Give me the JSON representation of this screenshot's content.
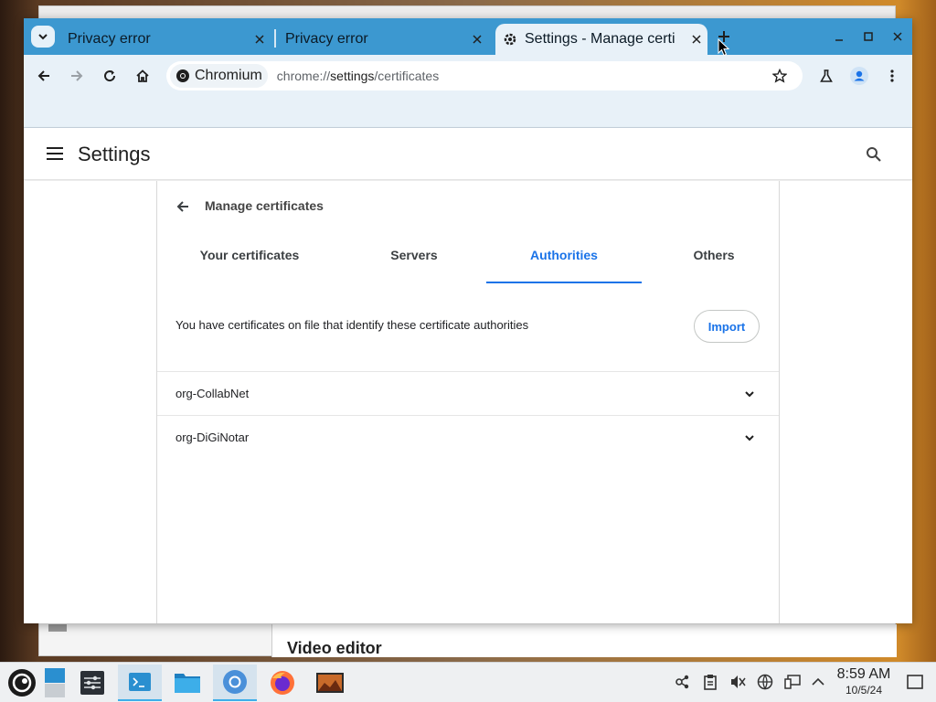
{
  "browser": {
    "tabs": [
      {
        "title": "Privacy error",
        "active": false
      },
      {
        "title": "Privacy error",
        "active": false
      },
      {
        "title": "Settings - Manage certi",
        "active": true
      }
    ],
    "omnibox": {
      "chip": "Chromium",
      "url_prefix": "chrome://",
      "url_host": "settings",
      "url_path": "/certificates"
    }
  },
  "settings": {
    "title": "Settings",
    "page_title": "Manage certificates",
    "tabs": [
      {
        "label": "Your certificates",
        "selected": false
      },
      {
        "label": "Servers",
        "selected": false
      },
      {
        "label": "Authorities",
        "selected": true
      },
      {
        "label": "Others",
        "selected": false
      }
    ],
    "description": "You have certificates on file that identify these certificate authorities",
    "import_label": "Import",
    "authorities": [
      {
        "name": "org-CollabNet"
      },
      {
        "name": "org-DiGiNotar"
      }
    ]
  },
  "background_window": {
    "heading": "Video editor"
  },
  "taskbar": {
    "apps": [
      "application-launcher-icon",
      "pager-icon",
      "system-settings-icon",
      "terminal-icon",
      "file-manager-icon",
      "chromium-icon",
      "firefox-icon",
      "media-app-icon"
    ],
    "clock": {
      "time": "8:59 AM",
      "date": "10/5/24"
    }
  },
  "colors": {
    "tabstrip": "#3c98d0",
    "toolbar": "#e8f1f8",
    "accent": "#1a73e8"
  }
}
